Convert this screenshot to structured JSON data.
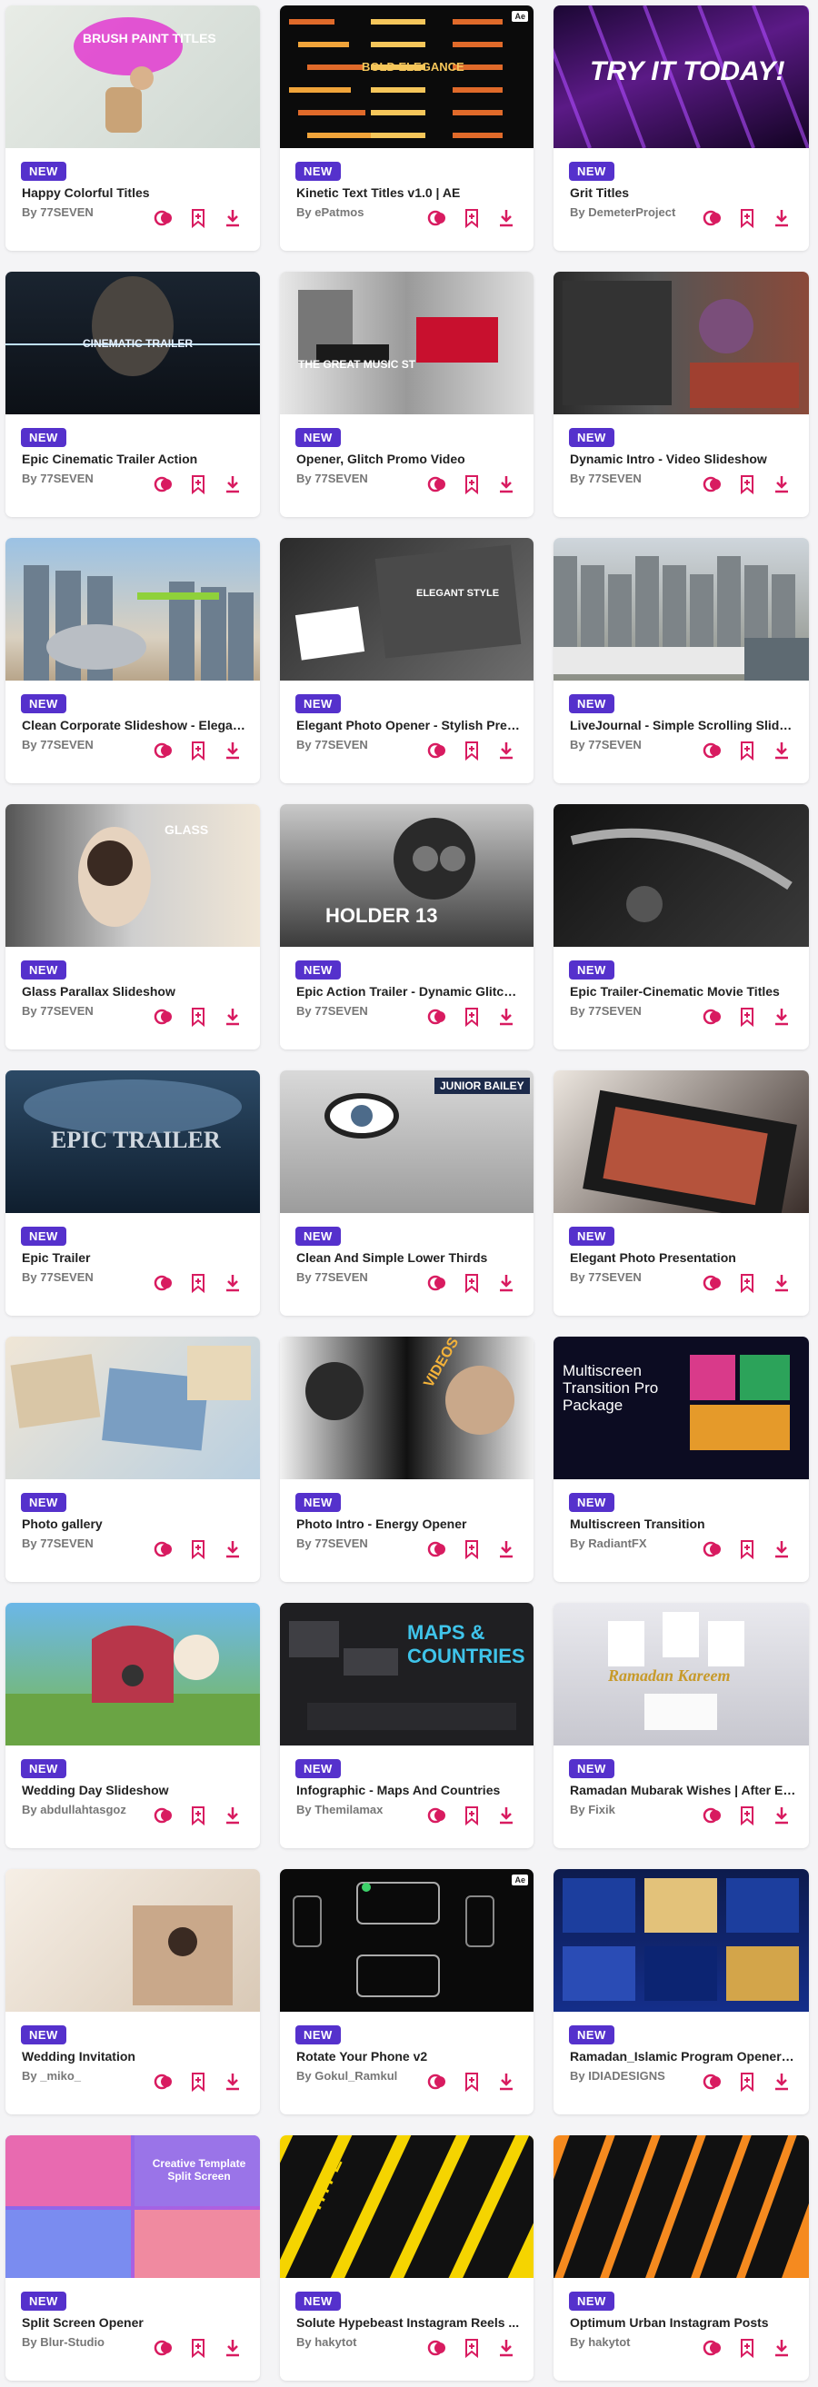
{
  "badge_label": "NEW",
  "author_prefix": "By ",
  "colors": {
    "accent": "#d81b60",
    "badge": "#5531cc"
  },
  "icons": {
    "preview": "preview-circles-icon",
    "bookmark": "bookmark-add-icon",
    "download": "download-icon"
  },
  "cards": [
    {
      "title": "Happy Colorful Titles",
      "author": "77SEVEN",
      "thumb_text": "BRUSH PAINT TITLES",
      "thumb_badge": ""
    },
    {
      "title": "Kinetic Text Titles v1.0 | AE",
      "author": "ePatmos",
      "thumb_text": "BOLD ELEGANCE",
      "thumb_badge": "Ae"
    },
    {
      "title": "Grit Titles",
      "author": "DemeterProject",
      "thumb_text": "TRY IT TODAY!",
      "thumb_badge": ""
    },
    {
      "title": "Epic Cinematic Trailer Action",
      "author": "77SEVEN",
      "thumb_text": "CINEMATIC TRAILER",
      "thumb_badge": ""
    },
    {
      "title": "Opener, Glitch Promo Video",
      "author": "77SEVEN",
      "thumb_text": "THE GREAT MUSIC ST",
      "thumb_badge": ""
    },
    {
      "title": "Dynamic Intro - Video Slideshow",
      "author": "77SEVEN",
      "thumb_text": "",
      "thumb_badge": ""
    },
    {
      "title": "Clean Corporate Slideshow - Elegan...",
      "author": "77SEVEN",
      "thumb_text": "",
      "thumb_badge": ""
    },
    {
      "title": "Elegant Photo Opener - Stylish Pres...",
      "author": "77SEVEN",
      "thumb_text": "ELEGANT STYLE",
      "thumb_badge": ""
    },
    {
      "title": "LiveJournal - Simple Scrolling Slides...",
      "author": "77SEVEN",
      "thumb_text": "",
      "thumb_badge": ""
    },
    {
      "title": "Glass Parallax Slideshow",
      "author": "77SEVEN",
      "thumb_text": "GLASS",
      "thumb_badge": ""
    },
    {
      "title": "Epic Action Trailer - Dynamic Glitch ...",
      "author": "77SEVEN",
      "thumb_text": "HOLDER 13",
      "thumb_badge": ""
    },
    {
      "title": "Epic Trailer-Cinematic Movie Titles",
      "author": "77SEVEN",
      "thumb_text": "",
      "thumb_badge": ""
    },
    {
      "title": "Epic Trailer",
      "author": "77SEVEN",
      "thumb_text": "EPIC TRAILER",
      "thumb_badge": ""
    },
    {
      "title": "Clean And Simple Lower Thirds",
      "author": "77SEVEN",
      "thumb_text": "JUNIOR BAILEY",
      "thumb_badge": ""
    },
    {
      "title": "Elegant Photo Presentation",
      "author": "77SEVEN",
      "thumb_text": "",
      "thumb_badge": ""
    },
    {
      "title": "Photo gallery",
      "author": "77SEVEN",
      "thumb_text": "",
      "thumb_badge": ""
    },
    {
      "title": "Photo Intro - Energy Opener",
      "author": "77SEVEN",
      "thumb_text": "VIDEOS",
      "thumb_badge": ""
    },
    {
      "title": "Multiscreen Transition",
      "author": "RadiantFX",
      "thumb_text": "Multiscreen Transition Pro Package",
      "thumb_badge": ""
    },
    {
      "title": "Wedding Day Slideshow",
      "author": "abdullahtasgoz",
      "thumb_text": "",
      "thumb_badge": ""
    },
    {
      "title": "Infographic - Maps And Countries",
      "author": "Themilamax",
      "thumb_text": "MAPS & COUNTRIES",
      "thumb_badge": ""
    },
    {
      "title": "Ramadan Mubarak Wishes | After Ef...",
      "author": "Fixik",
      "thumb_text": "Ramadan Kareem",
      "thumb_badge": ""
    },
    {
      "title": "Wedding Invitation",
      "author": "_miko_",
      "thumb_text": "",
      "thumb_badge": ""
    },
    {
      "title": "Rotate Your Phone v2",
      "author": "Gokul_Ramkul",
      "thumb_text": "",
      "thumb_badge": "Ae"
    },
    {
      "title": "Ramadan_Islamic Program Opener_...",
      "author": "IDIADESIGNS",
      "thumb_text": "",
      "thumb_badge": ""
    },
    {
      "title": "Split Screen Opener",
      "author": "Blur-Studio",
      "thumb_text": "Creative Template Split Screen",
      "thumb_badge": ""
    },
    {
      "title": "Solute Hypebeast Instagram Reels ...",
      "author": "hakytot",
      "thumb_text": "HYPE",
      "thumb_badge": ""
    },
    {
      "title": "Optimum Urban Instagram Posts",
      "author": "hakytot",
      "thumb_text": "",
      "thumb_badge": ""
    }
  ]
}
